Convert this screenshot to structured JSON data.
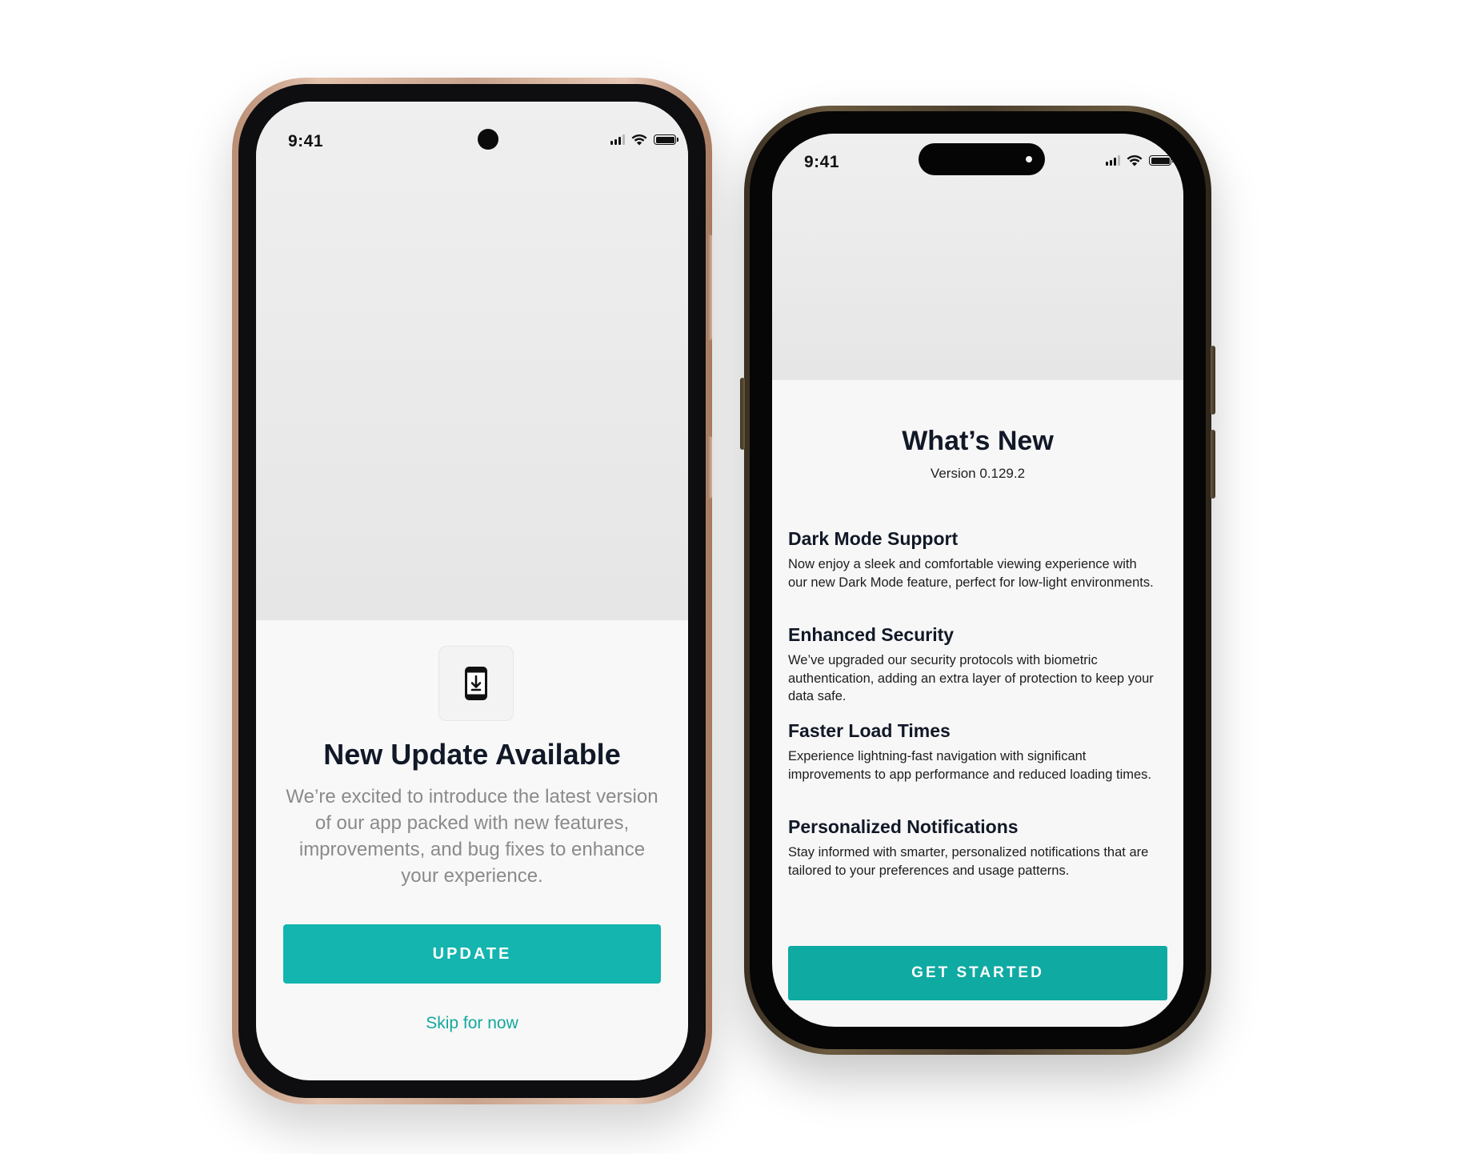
{
  "update_screen": {
    "status_time": "9:41",
    "title": "New Update Available",
    "description": "We’re excited to introduce the latest version of our app packed with new features, improvements, and bug fixes to enhance your experience.",
    "update_label": "UPDATE",
    "skip_label": "Skip for now",
    "icon": "phone-download-icon",
    "accent_color": "#14b5ae"
  },
  "whats_new_screen": {
    "status_time": "9:41",
    "title": "What’s New",
    "version": "Version 0.129.2",
    "features": [
      {
        "title": "Dark Mode Support",
        "description": "Now enjoy a sleek and comfortable viewing experience with our new Dark Mode feature, perfect for low-light environments."
      },
      {
        "title": "Enhanced Security",
        "description": "We’ve upgraded our security protocols with biometric authentication, adding an extra layer of protection to keep your data safe."
      },
      {
        "title": "Faster Load Times",
        "description": "Experience lightning-fast navigation with significant improvements to app performance and reduced loading times."
      },
      {
        "title": "Personalized Notifications",
        "description": "Stay informed with smarter, personalized notifications that are tailored to your preferences and usage patterns."
      }
    ],
    "cta_label": "GET STARTED",
    "accent_color": "#0faaa2"
  }
}
